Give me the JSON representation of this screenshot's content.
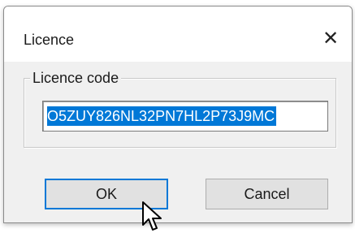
{
  "window": {
    "title": "Licence",
    "close_glyph": "✕"
  },
  "licence_group": {
    "legend": "Licence code",
    "code_value": "O5ZUY826NL32PN7HL2P73J9MC"
  },
  "buttons": {
    "ok_label": "OK",
    "cancel_label": "Cancel"
  },
  "colors": {
    "selection": "#0078d7",
    "dialog_bg": "#f0f0f0"
  },
  "icons": {
    "cursor": "mouse-pointer-icon"
  }
}
